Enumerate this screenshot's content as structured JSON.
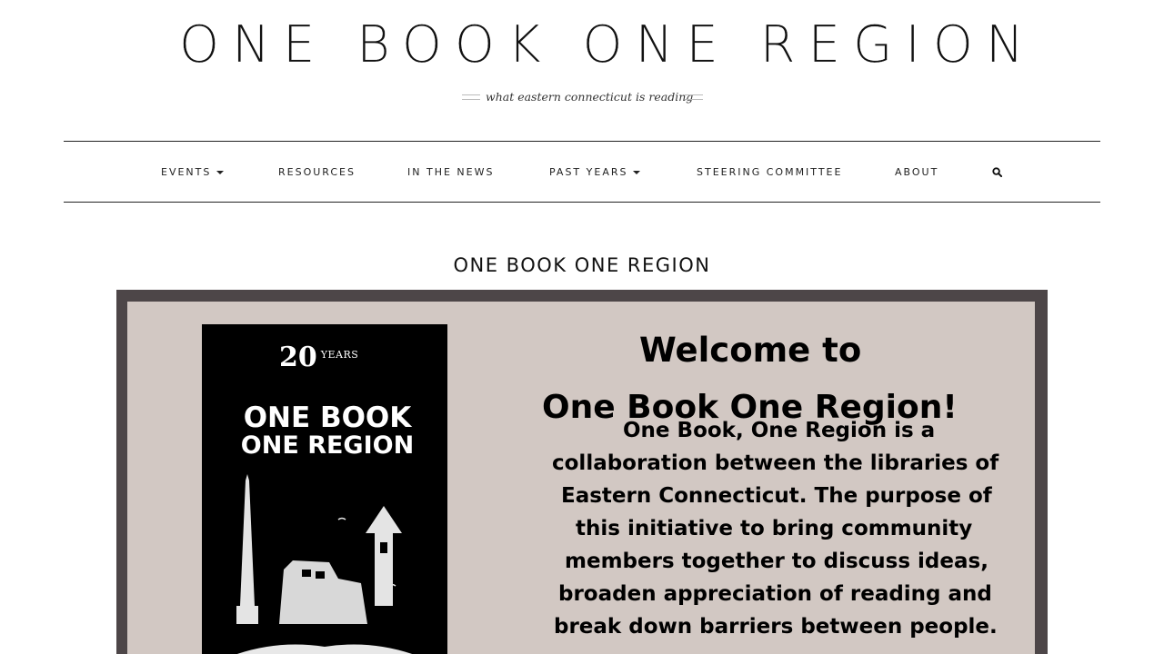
{
  "site": {
    "title": "ONE BOOK ONE REGION",
    "tagline": "what eastern connecticut is reading"
  },
  "nav": {
    "items": [
      {
        "label": "EVENTS",
        "has_dropdown": true
      },
      {
        "label": "RESOURCES",
        "has_dropdown": false
      },
      {
        "label": "IN THE NEWS",
        "has_dropdown": false
      },
      {
        "label": "PAST YEARS",
        "has_dropdown": true
      },
      {
        "label": "STEERING COMMITTEE",
        "has_dropdown": false
      },
      {
        "label": "ABOUT",
        "has_dropdown": false
      }
    ],
    "search_icon": "search-icon"
  },
  "page": {
    "heading": "ONE BOOK ONE REGION"
  },
  "banner": {
    "poster": {
      "years_number": "20",
      "years_word": "YEARS",
      "title_line1": "ONE BOOK",
      "title_line2": "ONE REGION"
    },
    "welcome_line1": "Welcome to",
    "welcome_line2": "One Book One Region!",
    "body_lines": [
      "One Book, One Region is a",
      "collaboration between the libraries of",
      "Eastern Connecticut. The purpose of",
      "this initiative to bring community",
      "members together to discuss ideas,",
      "broaden appreciation of reading and",
      "break down barriers between people."
    ]
  },
  "colors": {
    "banner_bg": "#d2c8c3",
    "banner_frame": "#4d4648",
    "poster_bg": "#000000"
  }
}
